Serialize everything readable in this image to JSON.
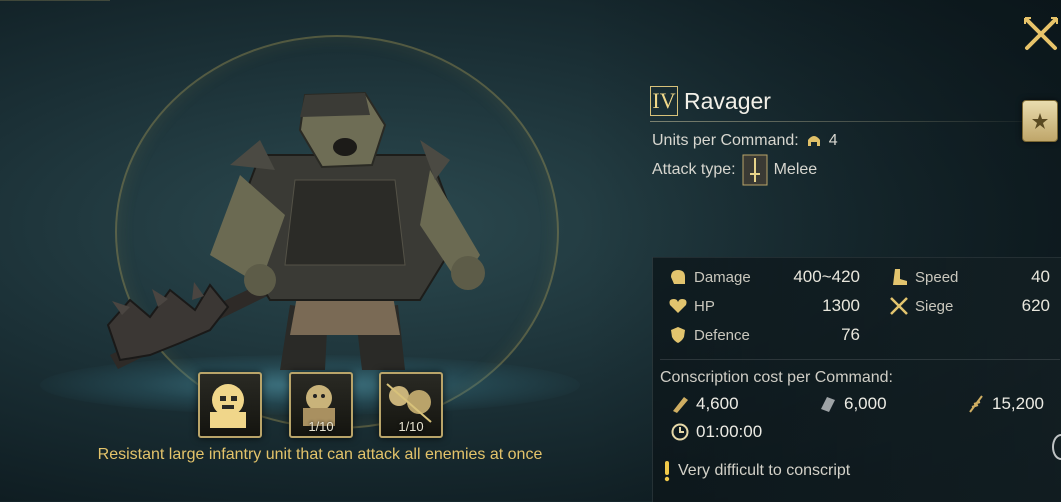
{
  "close_icon": "close-x-icon",
  "unit": {
    "tier": "IV",
    "name": "Ravager",
    "units_per_command_label": "Units per Command:",
    "units_per_command_value": "4",
    "attack_type_label": "Attack type:",
    "attack_type_value": "Melee"
  },
  "stats": {
    "damage_label": "Damage",
    "damage_value": "400~420",
    "hp_label": "HP",
    "hp_value": "1300",
    "defence_label": "Defence",
    "defence_value": "76",
    "speed_label": "Speed",
    "speed_value": "40",
    "siege_label": "Siege",
    "siege_value": "620"
  },
  "conscription": {
    "title": "Conscription cost per Command:",
    "wood": "4,600",
    "iron": "6,000",
    "grain": "15,200",
    "time": "01:00:00",
    "warning": "Very difficult to conscript"
  },
  "skills": [
    {
      "name": "skill-1",
      "count": ""
    },
    {
      "name": "skill-2",
      "count": "1/10"
    },
    {
      "name": "skill-3",
      "count": "1/10"
    }
  ],
  "description": "Resistant large infantry unit that can attack all enemies at once",
  "colors": {
    "gold": "#d8c27a",
    "description_text": "#e3c36a"
  }
}
